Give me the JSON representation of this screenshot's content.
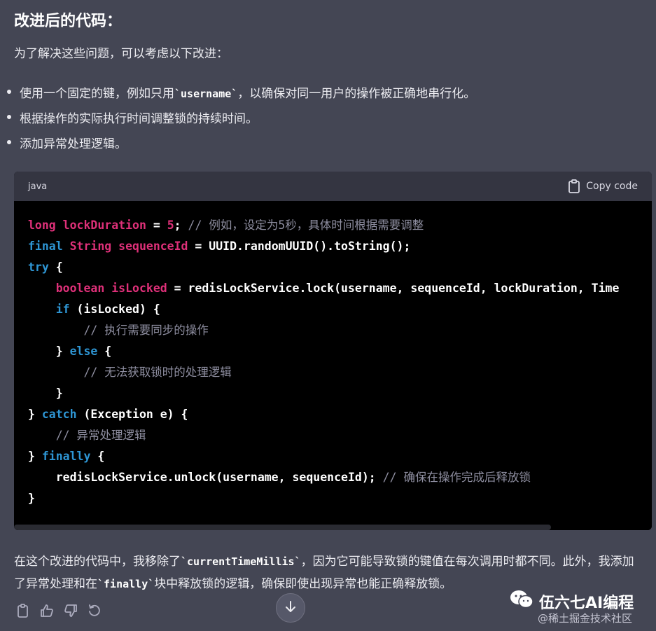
{
  "heading": "改进后的代码：",
  "intro": "为了解决这些问题，可以考虑以下改进：",
  "bullets": [
    {
      "pre": "使用一个固定的键，例如只用",
      "code": "`username`",
      "post": "，以确保对同一用户的操作被正确地串行化。"
    },
    {
      "pre": "根据操作的实际执行时间调整锁的持续时间。",
      "code": "",
      "post": ""
    },
    {
      "pre": "添加异常处理逻辑。",
      "code": "",
      "post": ""
    }
  ],
  "codeblock": {
    "language": "java",
    "copy_label": "Copy code",
    "lines": [
      [
        {
          "t": "long lockDuration",
          "c": "kw2"
        },
        {
          "t": " = ",
          "c": ""
        },
        {
          "t": "5",
          "c": "num"
        },
        {
          "t": "; ",
          "c": ""
        },
        {
          "t": "// 例如，设定为5秒，具体时间根据需要调整",
          "c": "cm"
        }
      ],
      [
        {
          "t": "final",
          "c": "kw"
        },
        {
          "t": " ",
          "c": ""
        },
        {
          "t": "String sequenceId",
          "c": "kw2"
        },
        {
          "t": " = UUID.randomUUID().toString();",
          "c": ""
        }
      ],
      [
        {
          "t": "try",
          "c": "kw"
        },
        {
          "t": " {",
          "c": ""
        }
      ],
      [
        {
          "t": "    ",
          "c": ""
        },
        {
          "t": "boolean isLocked",
          "c": "kw2"
        },
        {
          "t": " = redisLockService.lock(username, sequenceId, lockDuration, Time",
          "c": ""
        }
      ],
      [
        {
          "t": "    ",
          "c": ""
        },
        {
          "t": "if",
          "c": "kw"
        },
        {
          "t": " (isLocked) {",
          "c": ""
        }
      ],
      [
        {
          "t": "        ",
          "c": ""
        },
        {
          "t": "// 执行需要同步的操作",
          "c": "cm"
        }
      ],
      [
        {
          "t": "    } ",
          "c": ""
        },
        {
          "t": "else",
          "c": "kw"
        },
        {
          "t": " {",
          "c": ""
        }
      ],
      [
        {
          "t": "        ",
          "c": ""
        },
        {
          "t": "// 无法获取锁时的处理逻辑",
          "c": "cm"
        }
      ],
      [
        {
          "t": "    }",
          "c": ""
        }
      ],
      [
        {
          "t": "} ",
          "c": ""
        },
        {
          "t": "catch",
          "c": "kw"
        },
        {
          "t": " (Exception e) {",
          "c": ""
        }
      ],
      [
        {
          "t": "    ",
          "c": ""
        },
        {
          "t": "// 异常处理逻辑",
          "c": "cm"
        }
      ],
      [
        {
          "t": "} ",
          "c": ""
        },
        {
          "t": "finally",
          "c": "kw"
        },
        {
          "t": " {",
          "c": ""
        }
      ],
      [
        {
          "t": "    redisLockService.unlock(username, sequenceId); ",
          "c": ""
        },
        {
          "t": "// 确保在操作完成后释放锁",
          "c": "cm"
        }
      ],
      [
        {
          "t": "}",
          "c": ""
        }
      ]
    ]
  },
  "outro": {
    "p1": "在这个改进的代码中，我移除了",
    "c1": "`currentTimeMillis`",
    "p2": "，因为它可能导致锁的键值在每次调用时都不同。此外，我添加了异常处理和在",
    "c2": "`finally`",
    "p3": "块中释放锁的逻辑，确保即使出现异常也能正确释放锁。"
  },
  "actions": [
    "clipboard-icon",
    "thumbs-up-icon",
    "thumbs-down-icon",
    "regenerate-icon"
  ],
  "watermark": {
    "title": "伍六七AI编程",
    "sub": "@稀土掘金技术社区"
  },
  "colors": {
    "background": "#444654",
    "code_bg": "#000000",
    "code_header_bg": "#343541",
    "keyword": "#2e95d3",
    "type": "#df3079",
    "comment": "#8e8ea0"
  }
}
